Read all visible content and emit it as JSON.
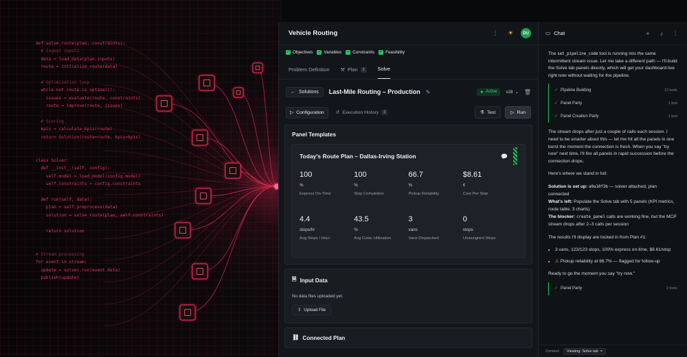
{
  "colors": {
    "accent_green": "#22c55e",
    "neon_pink": "#ff2a5f",
    "bg": "#12161a"
  },
  "art": {
    "code_lines": [
      "def solve_route(plan, constraints):",
      "  # Ingest inputs",
      "  data = load_data(plan.inputs)",
      "  route = initialize_route(data)",
      "",
      "  # Optimization loop",
      "  while not route.is_optimal():",
      "    issues = evaluate(route, constraints)",
      "    route = improve(route, issues)",
      "",
      "  # Scoring",
      "  kpis = calculate_kpis(route)",
      "  return Solution(route=route, kpis=kpis)",
      "",
      "",
      "class Solver:",
      "  def __init__(self, config):",
      "    self.model = load_model(config.model)",
      "    self.constraints = config.constraints",
      "",
      "  def run(self, data):",
      "    plan = self.preprocess(data)",
      "    solution = solve_route(plan, self.constraints)",
      "",
      "    return solution",
      "",
      "",
      "# Stream processing",
      "for event in stream:",
      "  update = solver.run(event.data)",
      "  publish(update)"
    ]
  },
  "main": {
    "title": "Vehicle Routing",
    "avatar": "DU",
    "chips": [
      "Objectives",
      "Variables",
      "Constraints",
      "Feasibility"
    ],
    "tabs": [
      {
        "label": "Problem Definition",
        "count": ""
      },
      {
        "label": "Plan",
        "count": "2"
      },
      {
        "label": "Solve",
        "count": ""
      }
    ],
    "solutions_label": "Solutions",
    "solution_title": "Last-Mile Routing – Production",
    "status": "Active",
    "version": "v28",
    "config_tab": "Configuration",
    "history_tab": "Execution History",
    "history_count": "2",
    "test_label": "Test",
    "run_label": "Run",
    "panel_templates": "Panel Templates",
    "route_plan_title": "Today's Route Plan – Dallas-Irving Station",
    "kpis": [
      {
        "value": "100",
        "unit": "%",
        "label": "Express On-Time"
      },
      {
        "value": "100",
        "unit": "%",
        "label": "Stop Completion"
      },
      {
        "value": "66.7",
        "unit": "%",
        "label": "Pickup Reliability"
      },
      {
        "value": "$8.61",
        "unit": "¢",
        "label": "Cost Per Stop"
      },
      {
        "value": "4.4",
        "unit": "stops/hr",
        "label": "Avg Stops / Hour"
      },
      {
        "value": "43.5",
        "unit": "%",
        "label": "Avg Cubic Utilization"
      },
      {
        "value": "3",
        "unit": "vans",
        "label": "Vans Dispatched"
      },
      {
        "value": "0",
        "unit": "stops",
        "label": "Unassigned Stops"
      }
    ],
    "input_data_title": "Input Data",
    "input_empty": "No data files uploaded yet.",
    "upload_label": "Upload File",
    "connected_plan_title": "Connected Plan"
  },
  "chat": {
    "title": "Chat",
    "p1_before": "The ",
    "p1_code": "set_pipeline_code",
    "p1_after": " tool is running into the same intermittent stream issue. Let me take a different path — I'll build the Solve tab panels directly, which will get your dashboard live right now without waiting for the pipeline.",
    "tools_a": [
      {
        "name": "Pipeline Building",
        "count": "12 tools"
      },
      {
        "name": "Panel Party",
        "count": "1 tool"
      },
      {
        "name": "Panel Creation Party",
        "count": "1 tool"
      }
    ],
    "p2": "The stream drops after just a couple of calls each session. I need to be smarter about this — let me hit all the panels in one burst the moment the connection is fresh. When you say \"try now\" next time, I'll fire all panels in rapid succession before the connection drops.",
    "p3": "Here's where we stand in full:",
    "setup_label": "Solution is set up:",
    "setup_code": "a0a10f3b",
    "setup_rest": " — solver attached, plan connected",
    "left_label": "What's left:",
    "left_rest": " Populate the Solve tab with 5 panels (KPI metrics, route table, 3 charts)",
    "blocker_label": "The blocker:",
    "blocker_code": "create_panel",
    "blocker_rest": " calls are working fine, but the MCP stream drops after 2–3 calls per session",
    "p4": "The results I'll display are locked in from Plan #1:",
    "bullet1": "3 vans, 123/123 stops, 100% express on-time, $8.61/stop",
    "bullet2": "Pickup reliability at 66.7% — flagged for follow-up",
    "p5": "Ready to go the moment you say \"try now.\"",
    "tools_b": [
      {
        "name": "Panel Party",
        "count": "2 tools"
      }
    ],
    "context_label": "Context:",
    "context_chip": "Viewing: Solve tab"
  }
}
